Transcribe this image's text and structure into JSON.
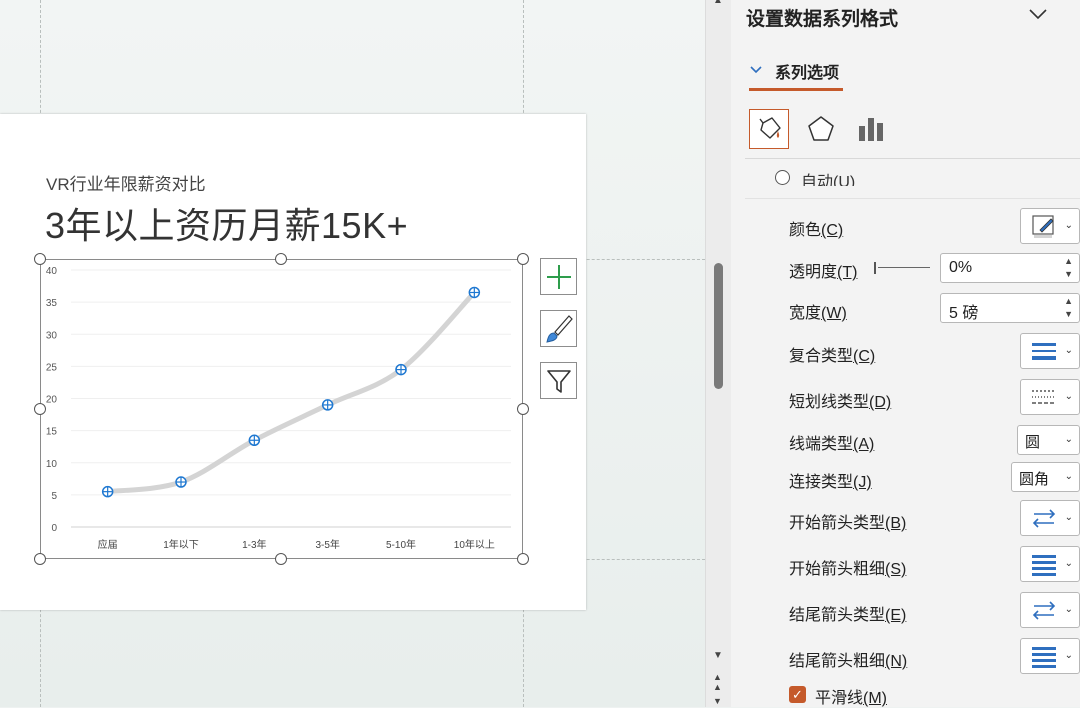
{
  "slide": {
    "subtitle": "VR行业年限薪资对比",
    "title": "3年以上资历月薪15K+"
  },
  "chart_data": {
    "type": "line",
    "smooth": true,
    "categories": [
      "应届",
      "1年以下",
      "1-3年",
      "3-5年",
      "5-10年",
      "10年以上"
    ],
    "series": [
      {
        "values": [
          5.5,
          7,
          13.5,
          19,
          24.5,
          36.5
        ]
      }
    ],
    "y_ticks": [
      "0",
      "5",
      "10",
      "15",
      "20",
      "25",
      "30",
      "35",
      "40"
    ],
    "ylim": [
      0,
      40
    ],
    "grid": true,
    "line_color": "#d4d4d4",
    "marker_color": "#1f78d1"
  },
  "chart_buttons": {
    "elements": "chart-elements-plus-icon",
    "styles": "chart-styles-brush-icon",
    "filters": "chart-filters-funnel-icon"
  },
  "pane": {
    "title": "设置数据系列格式",
    "tab_label": "系列选项",
    "auto_label": "自动(U)",
    "rows": {
      "color": "颜色",
      "color_key": "(C)",
      "transparency": "透明度",
      "transparency_key": "(T)",
      "width": "宽度",
      "width_key": "(W)",
      "compound": "复合类型",
      "compound_key": "(C)",
      "dash": "短划线类型",
      "dash_key": "(D)",
      "cap": "线端类型",
      "cap_key": "(A)",
      "join": "连接类型",
      "join_key": "(J)",
      "begin_arrow_type": "开始箭头类型",
      "begin_arrow_type_key": "(B)",
      "begin_arrow_size": "开始箭头粗细",
      "begin_arrow_size_key": "(S)",
      "end_arrow_type": "结尾箭头类型",
      "end_arrow_type_key": "(E)",
      "end_arrow_size": "结尾箭头粗细",
      "end_arrow_size_key": "(N)",
      "smooth": "平滑线",
      "smooth_key": "(M)"
    },
    "values": {
      "transparency": "0%",
      "width": "5 磅",
      "cap": "圆",
      "join": "圆角",
      "smooth_checked": true
    },
    "accent": "#c55a2b"
  }
}
